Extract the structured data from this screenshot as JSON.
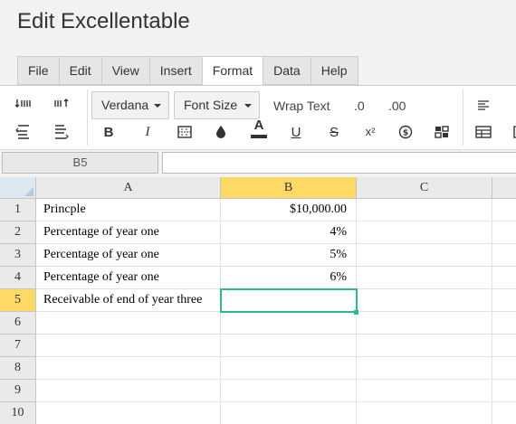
{
  "app": {
    "title": "Edit Excellentable"
  },
  "menu": {
    "tabs": [
      {
        "label": "File"
      },
      {
        "label": "Edit"
      },
      {
        "label": "View"
      },
      {
        "label": "Insert"
      },
      {
        "label": "Format",
        "active": true
      },
      {
        "label": "Data"
      },
      {
        "label": "Help"
      }
    ]
  },
  "toolbar": {
    "font_family": "Verdana",
    "font_size": "Font Size",
    "wrap_text": "Wrap Text",
    "decimal_decrease": ".0",
    "decimal_increase": ".00",
    "bold": "B",
    "italic": "I",
    "font_color_letter": "A",
    "underline": "U",
    "strikethrough": "S",
    "superscript": "x²"
  },
  "formula_bar": {
    "cell_ref": "B5",
    "value": ""
  },
  "sheet": {
    "columns": [
      "A",
      "B",
      "C"
    ],
    "selected_column": "B",
    "selected_row": 5,
    "rows": [
      {
        "num": "1",
        "a": "Princple",
        "b": "$10,000.00",
        "c": ""
      },
      {
        "num": "2",
        "a": "Percentage of year one",
        "b": "4%",
        "c": ""
      },
      {
        "num": "3",
        "a": "Percentage of year one",
        "b": "5%",
        "c": ""
      },
      {
        "num": "4",
        "a": "Percentage of year one",
        "b": "6%",
        "c": ""
      },
      {
        "num": "5",
        "a": "Receivable of end of year three",
        "b": "",
        "c": ""
      },
      {
        "num": "6",
        "a": "",
        "b": "",
        "c": ""
      },
      {
        "num": "7",
        "a": "",
        "b": "",
        "c": ""
      },
      {
        "num": "8",
        "a": "",
        "b": "",
        "c": ""
      },
      {
        "num": "9",
        "a": "",
        "b": "",
        "c": ""
      },
      {
        "num": "10",
        "a": "",
        "b": "",
        "c": ""
      }
    ]
  },
  "colors": {
    "accent_selection": "#2eb88f",
    "header_highlight": "#ffd966"
  }
}
